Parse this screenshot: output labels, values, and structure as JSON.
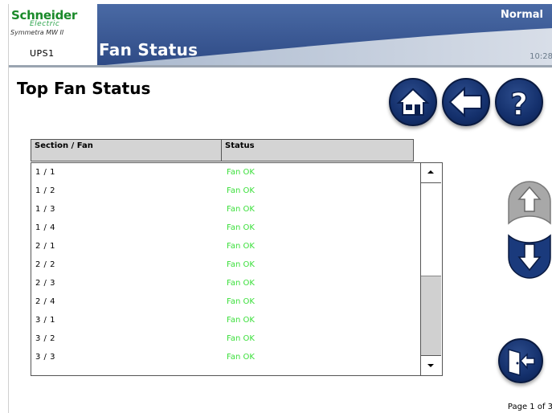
{
  "header": {
    "brand_name": "Schneider",
    "brand_sub": "Electric",
    "product": "Symmetra MW II",
    "unit_label": "UPS1",
    "screen_title": "Fan Status",
    "mode": "Normal",
    "time": "10:28"
  },
  "page": {
    "title": "Top Fan Status",
    "indicator": "Page 1 of 3"
  },
  "nav": {
    "home_icon": "home-icon",
    "back_icon": "back-arrow-icon",
    "help_icon": "help-icon"
  },
  "table": {
    "columns": [
      "Section / Fan",
      "Status"
    ],
    "rows": [
      {
        "fan": "1 / 1",
        "status": "Fan OK"
      },
      {
        "fan": "1 / 2",
        "status": "Fan OK"
      },
      {
        "fan": "1 / 3",
        "status": "Fan OK"
      },
      {
        "fan": "1 / 4",
        "status": "Fan OK"
      },
      {
        "fan": "2 / 1",
        "status": "Fan OK"
      },
      {
        "fan": "2 / 2",
        "status": "Fan OK"
      },
      {
        "fan": "2 / 3",
        "status": "Fan OK"
      },
      {
        "fan": "2 / 4",
        "status": "Fan OK"
      },
      {
        "fan": "3 / 1",
        "status": "Fan OK"
      },
      {
        "fan": "3 / 2",
        "status": "Fan OK"
      },
      {
        "fan": "3 / 3",
        "status": "Fan OK"
      }
    ]
  },
  "colors": {
    "banner": "#3a5a95",
    "status_ok": "#3adf3a",
    "button_blue": "#14306c",
    "brand_green": "#1a8a2a"
  }
}
